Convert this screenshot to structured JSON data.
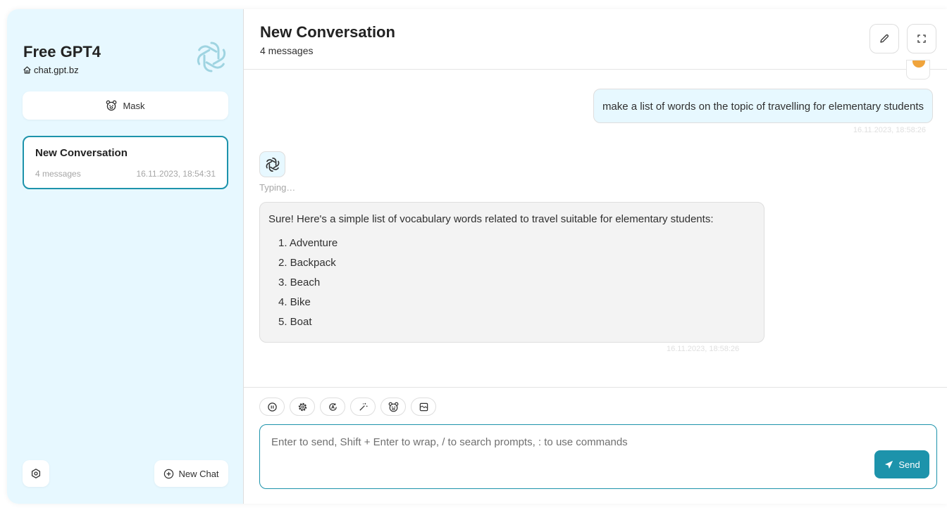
{
  "sidebar": {
    "brand_title": "Free GPT4",
    "brand_subtitle": "chat.gpt.bz",
    "mask_label": "Mask",
    "conversation": {
      "title": "New Conversation",
      "count": "4 messages",
      "time": "16.11.2023, 18:54:31"
    },
    "new_chat_label": "New Chat"
  },
  "header": {
    "title": "New Conversation",
    "subtitle": "4 messages"
  },
  "messages": {
    "user_text": "make a list of words on the topic of travelling for elementary students",
    "user_time": "16.11.2023, 18:58:26",
    "bot_status": "Typing…",
    "bot_intro": "Sure! Here's a simple list of vocabulary words related to travel suitable for elementary students:",
    "bot_items": [
      "1. Adventure",
      "2. Backpack",
      "3. Beach",
      "4. Bike",
      "5. Boat"
    ],
    "bot_time": "16.11.2023, 18:58:26"
  },
  "composer": {
    "placeholder": "Enter to send, Shift + Enter to wrap, / to search prompts, : to use commands",
    "send_label": "Send"
  },
  "icons": {
    "brand": "openai-logo-icon",
    "home": "home-icon",
    "mask": "bear-face-icon",
    "settings": "settings-icon",
    "new_chat": "plus-circle-icon",
    "edit": "pencil-icon",
    "fullscreen": "expand-icon",
    "send": "send-arrow-icon"
  },
  "colors": {
    "accent": "#1d93ab",
    "sidebar_bg": "#e7f8ff",
    "bot_bubble": "#f3f3f3"
  }
}
